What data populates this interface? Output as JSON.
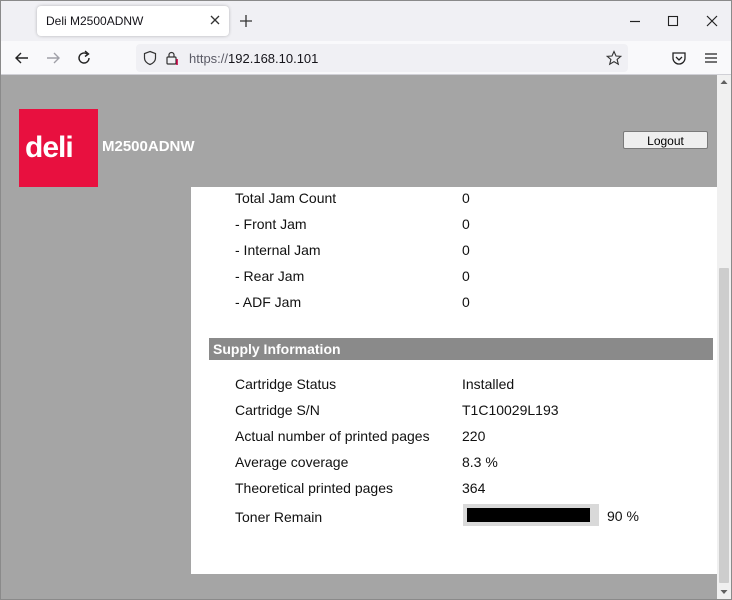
{
  "browser": {
    "tab_title": "Deli M2500ADNW",
    "url_scheme": "https://",
    "url_host": "192.168.10.101"
  },
  "header": {
    "logo_text": "deli",
    "model": "M2500ADNW",
    "logout_label": "Logout"
  },
  "jam_rows": [
    {
      "label": "Total Jam Count",
      "value": "0"
    },
    {
      "label": "- Front Jam",
      "value": "0"
    },
    {
      "label": "- Internal Jam",
      "value": "0"
    },
    {
      "label": "- Rear Jam",
      "value": "0"
    },
    {
      "label": "- ADF Jam",
      "value": "0"
    }
  ],
  "supply": {
    "section_title": "Supply Information",
    "rows": [
      {
        "label": "Cartridge Status",
        "value": "Installed"
      },
      {
        "label": "Cartridge S/N",
        "value": "T1C10029L193"
      },
      {
        "label": "Actual number of printed pages",
        "value": "220"
      },
      {
        "label": "Average coverage",
        "value": "8.3 %"
      },
      {
        "label": "Theoretical printed pages",
        "value": "364"
      }
    ],
    "toner_label": "Toner Remain",
    "toner_percent": 90,
    "toner_text": "90 %"
  },
  "colors": {
    "brand": "#e8103f",
    "section_bar": "#8a8a8a",
    "page_background": "#a5a5a5"
  }
}
